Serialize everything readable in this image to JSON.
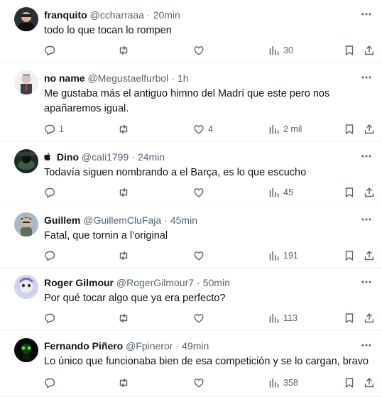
{
  "tweets": [
    {
      "name": "franquito",
      "name_prefix_icon": "",
      "handle": "@ccharraaa",
      "time": "20min",
      "text": "todo lo que tocan lo rompen",
      "replies": "",
      "retweets": "",
      "likes": "",
      "views": "30",
      "avatar_color": "#1f2937"
    },
    {
      "name": "no name",
      "name_prefix_icon": "",
      "handle": "@Megustaelfurbol",
      "time": "1h",
      "text": "Me gustaba más el antiguo himno del Madrí que este pero nos apañaremos igual.",
      "replies": "1",
      "retweets": "",
      "likes": "4",
      "views": "2 mil",
      "avatar_color": "#c9ccd3"
    },
    {
      "name": "Dino",
      "name_prefix_icon": "apple-icon",
      "handle": "@cali1799",
      "time": "24min",
      "text": "Todavía siguen nombrando a el Barça, es lo que escucho",
      "replies": "",
      "retweets": "",
      "likes": "",
      "views": "45",
      "avatar_color": "#2b3a2e"
    },
    {
      "name": "Guillem",
      "name_prefix_icon": "",
      "handle": "@GuillemCluFaja",
      "time": "45min",
      "text": "Fatal, que tornin a l’original",
      "replies": "",
      "retweets": "",
      "likes": "",
      "views": "191",
      "avatar_color": "#8a9aa6"
    },
    {
      "name": "Roger Gilmour",
      "name_prefix_icon": "",
      "handle": "@RogerGilmour7",
      "time": "50min",
      "text": "Por qué tocar algo que ya era perfecto?",
      "replies": "",
      "retweets": "",
      "likes": "",
      "views": "113",
      "avatar_color": "#b6b9e4"
    },
    {
      "name": "Fernando Piñero",
      "name_prefix_icon": "",
      "handle": "@Fpineror",
      "time": "49min",
      "text": "Lo único que funcionaba bien de esa competición y se lo cargan, bravo",
      "replies": "",
      "retweets": "",
      "likes": "",
      "views": "358",
      "avatar_color": "#0b140b"
    }
  ]
}
